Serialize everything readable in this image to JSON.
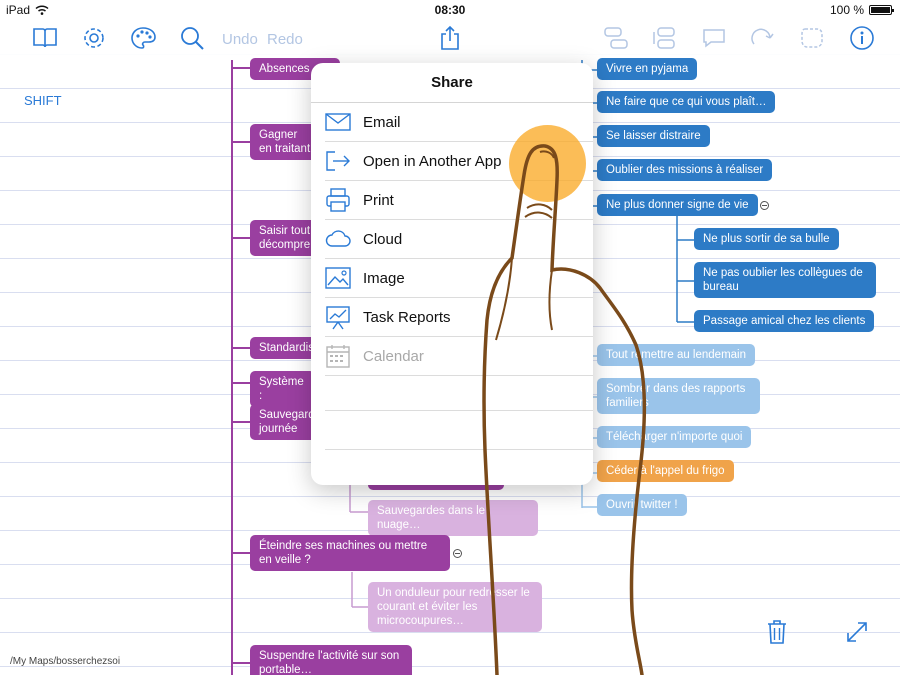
{
  "status_bar": {
    "device": "iPad",
    "time": "08:30",
    "battery": "100 %"
  },
  "toolbar": {
    "undo_label": "Undo",
    "redo_label": "Redo"
  },
  "sidebar_label": "SHIFT",
  "left_nodes": [
    "Absences",
    "Gagner en traitant",
    "Saisir tout décompre",
    "Standardis",
    "Système :",
    "Sauvegard journée",
    "",
    "Sauvegardes dans le nuage…",
    "Éteindre ses machines ou mettre en veille ?",
    "Un onduleur pour redresser le courant et éviter les microcoupures…",
    "Suspendre l'activité sur son portable…"
  ],
  "right_nodes": [
    "Vivre en pyjama",
    "Ne faire que ce qui vous plaît…",
    "Se laisser distraire",
    "Oublier des missions à réaliser",
    "Ne plus donner signe de vie",
    "Ne plus sortir de sa bulle",
    "Ne pas oublier les collègues de bureau",
    "Passage amical chez les clients",
    "Tout remettre au lendemain",
    "Sombrer dans des rapports familiers",
    "Télécharger n'importe quoi",
    "Céder à l'appel du frigo",
    "Ouvrir twitter !"
  ],
  "share_popover": {
    "title": "Share",
    "items": [
      {
        "label": "Email",
        "icon": "envelope-icon",
        "enabled": true
      },
      {
        "label": "Open in Another App",
        "icon": "open-in-app-icon",
        "enabled": true
      },
      {
        "label": "Print",
        "icon": "printer-icon",
        "enabled": true
      },
      {
        "label": "Cloud",
        "icon": "cloud-icon",
        "enabled": true
      },
      {
        "label": "Image",
        "icon": "image-icon",
        "enabled": true
      },
      {
        "label": "Task Reports",
        "icon": "task-report-icon",
        "enabled": true
      },
      {
        "label": "Calendar",
        "icon": "calendar-icon",
        "enabled": false
      }
    ]
  },
  "file_path": "/My Maps/bosserchezsoi",
  "colors": {
    "accent": "#2a7ad6",
    "purple_node": "#9a3fa0",
    "light_purple_node": "#d9b2df",
    "blue_node": "#2d7bc6",
    "light_blue_node": "#9ac4ea",
    "orange_node": "#f0a34a",
    "touch_indicator": "#faaa28"
  }
}
